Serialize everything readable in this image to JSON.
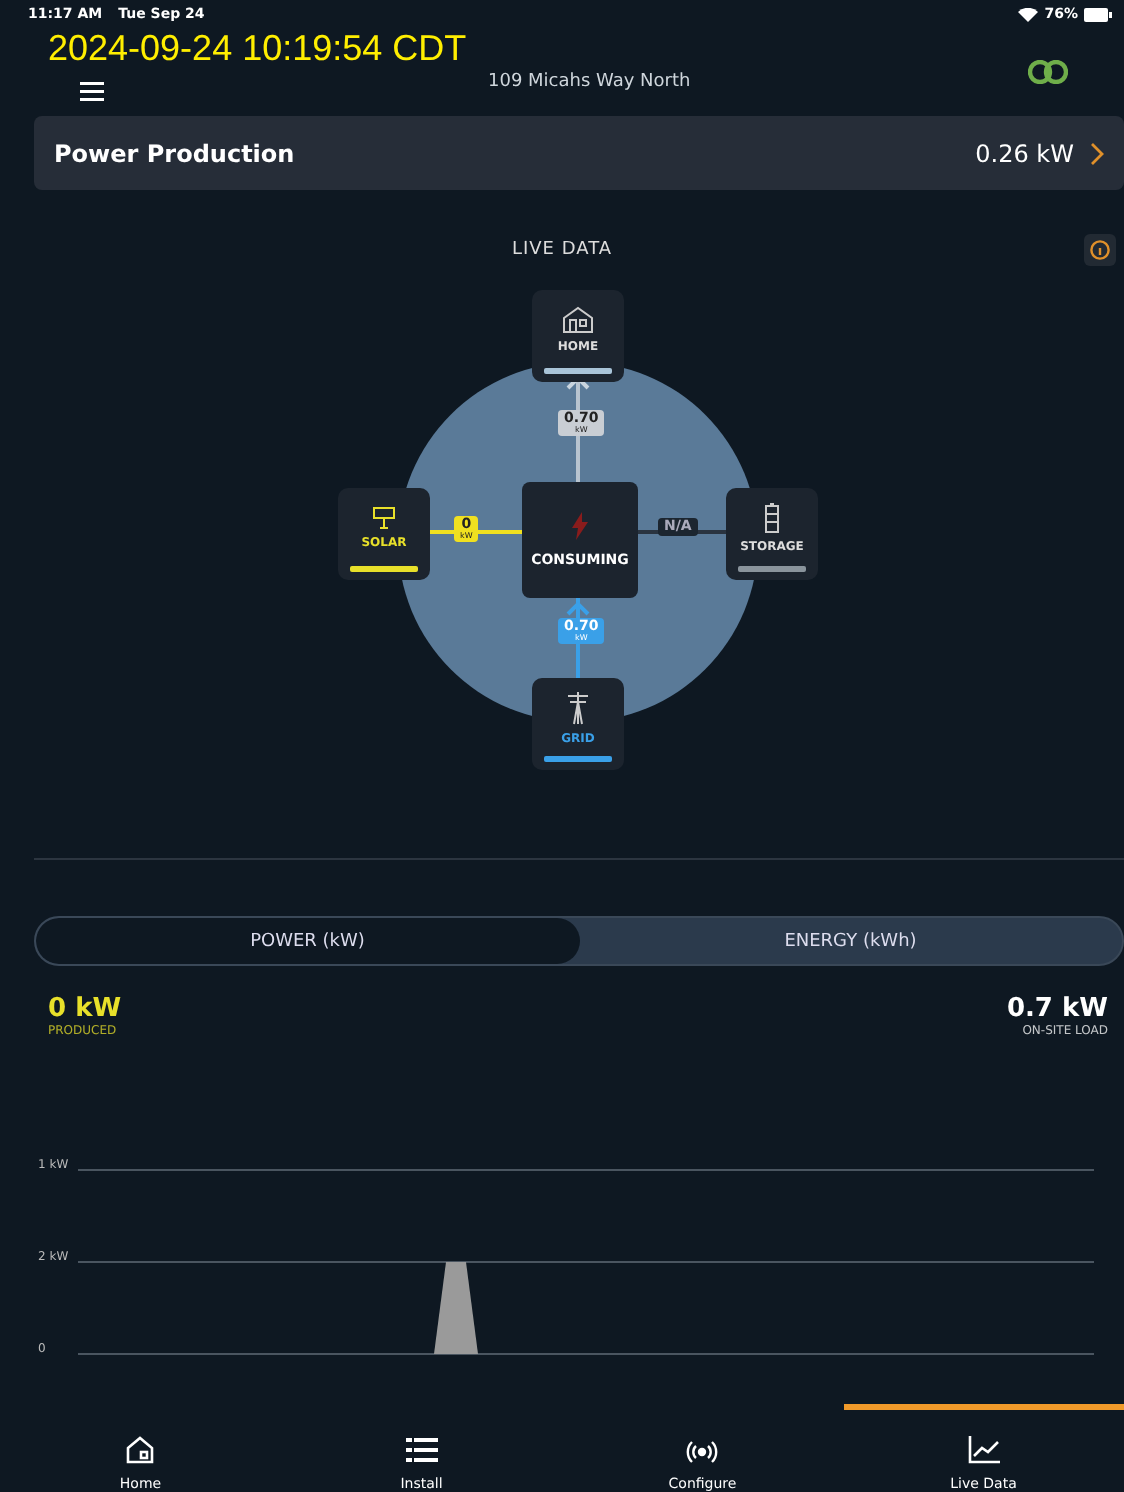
{
  "status_bar": {
    "time": "11:17 AM",
    "date": "Tue Sep 24",
    "battery": "76%"
  },
  "timestamp_overlay": "2024-09-24 10:19:54 CDT",
  "header": {
    "address": "109 Micahs Way North"
  },
  "summary_card": {
    "title": "Power Production",
    "value": "0.26 kW"
  },
  "live_data": {
    "title": "LIVE DATA",
    "center": {
      "label": "CONSUMING"
    },
    "nodes": [
      {
        "kind": "home",
        "label": "HOME",
        "color": "#a9c4d8",
        "flow": {
          "value": "0.70",
          "unit": "kW"
        }
      },
      {
        "kind": "solar",
        "label": "SOLAR",
        "color": "#e8e02a",
        "flow": {
          "value": "0",
          "unit": "kW"
        }
      },
      {
        "kind": "storage",
        "label": "STORAGE",
        "color": "#8a949c",
        "flow": {
          "value": "N/A"
        }
      },
      {
        "kind": "grid",
        "label": "GRID",
        "color": "#3aa0e8",
        "flow": {
          "value": "0.70",
          "unit": "kW"
        }
      }
    ]
  },
  "mode_tabs": [
    {
      "label": "POWER (kW)",
      "selected": true
    },
    {
      "label": "ENERGY (kWh)",
      "selected": false
    }
  ],
  "stats": [
    {
      "value": "0 kW",
      "label": "PRODUCED",
      "color": "#e8e02a"
    },
    {
      "value": "0.7 kW",
      "label": "ON-SITE LOAD",
      "color": "#ffffff"
    }
  ],
  "chart": {
    "axis_labels": [
      "1 kW",
      "2 kW",
      "0"
    ]
  },
  "nav": [
    {
      "kind": "home",
      "label": "Home",
      "selected": false
    },
    {
      "kind": "install",
      "label": "Install",
      "selected": false
    },
    {
      "kind": "configure",
      "label": "Configure",
      "selected": false
    },
    {
      "kind": "live",
      "label": "Live Data",
      "selected": true
    }
  ]
}
